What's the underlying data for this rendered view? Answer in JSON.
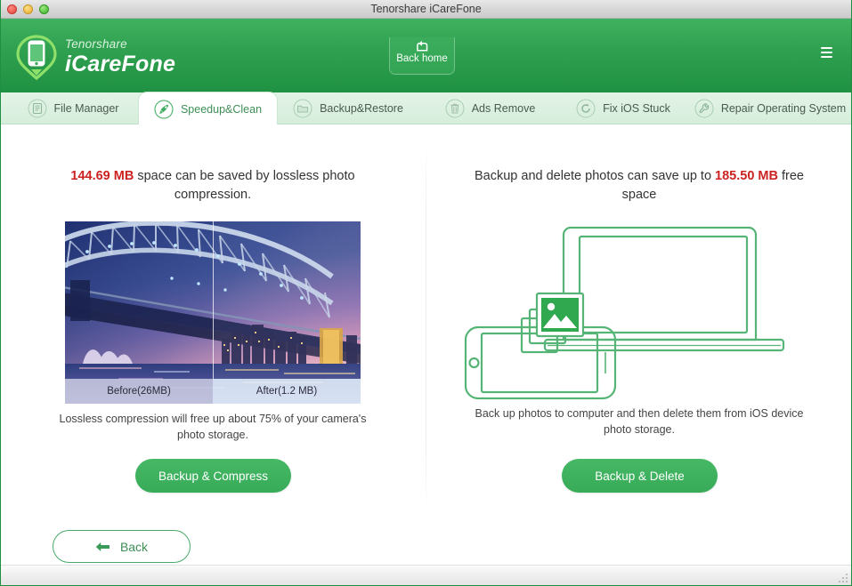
{
  "window": {
    "title": "Tenorshare iCareFone",
    "traffic_lights": [
      "close-red",
      "minimize-yellow",
      "zoom-green"
    ]
  },
  "header": {
    "brand_top": "Tenorshare",
    "brand_main": "iCareFone",
    "logo_icon": "phone-pin-logo-icon",
    "back_home": {
      "label": "Back home",
      "icon": "back-home-icon"
    },
    "menu_icon": "hamburger-menu-icon"
  },
  "tabs": [
    {
      "label": "File Manager",
      "icon": "file-manager-icon",
      "active": false
    },
    {
      "label": "Speedup&Clean",
      "icon": "rocket-clean-icon",
      "active": true
    },
    {
      "label": "Backup&Restore",
      "icon": "folder-icon",
      "active": false
    },
    {
      "label": "Ads Remove",
      "icon": "trash-icon",
      "active": false
    },
    {
      "label": "Fix iOS Stuck",
      "icon": "refresh-icon",
      "active": false
    },
    {
      "label": "Repair Operating System",
      "icon": "wrench-icon",
      "active": false
    }
  ],
  "left_panel": {
    "headline_value": "144.69 MB",
    "headline_rest": " space can be saved by lossless photo compression.",
    "photo_alt": "sydney-harbour-bridge-before-after-compression",
    "caption_before": "Before(26MB)",
    "caption_after": "After(1.2 MB)",
    "subtext": "Lossless compression will free up about 75% of your camera's photo storage.",
    "button_label": "Backup & Compress"
  },
  "right_panel": {
    "headline_pre": "Backup and delete photos can save up to ",
    "headline_value": "185.50 MB",
    "headline_post": " free space",
    "illustration": "phone-to-laptop-photo-transfer-icon",
    "subtext": "Back up photos to computer and then delete them from iOS device photo storage.",
    "button_label": "Backup & Delete"
  },
  "footer": {
    "back_label": "Back",
    "back_icon": "arrow-left-icon"
  },
  "colors": {
    "brand_green": "#2fa150",
    "accent_green": "#3cae5d",
    "highlight_red": "#cc2222",
    "tabbar_bg": "#dcf0e1"
  }
}
